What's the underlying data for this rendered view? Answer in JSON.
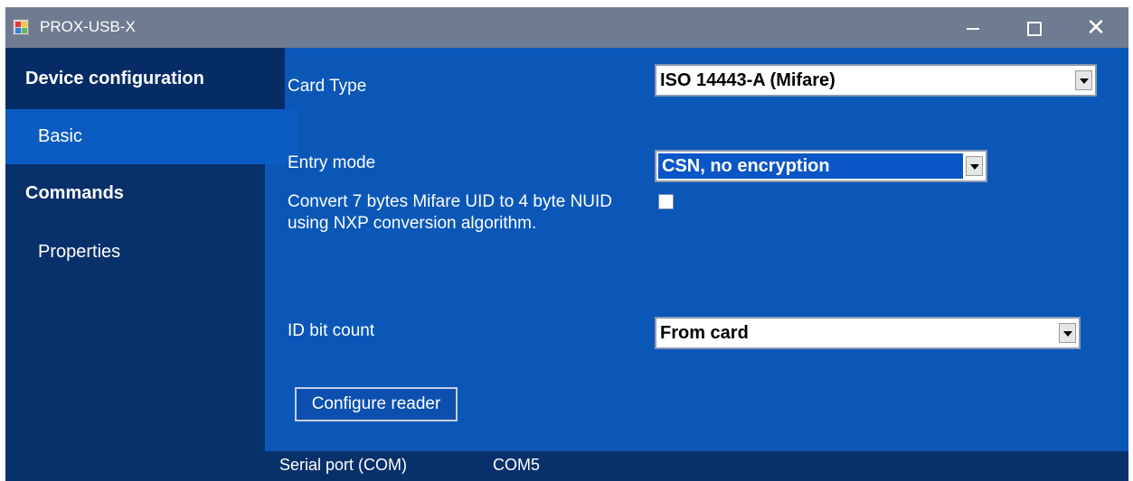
{
  "window": {
    "title": "PROX-USB-X",
    "icon": "app-icon",
    "controls": {
      "minimize": "minimize-icon",
      "maximize": "maximize-icon",
      "close": "close-icon"
    }
  },
  "sidebar": {
    "items": [
      {
        "label": "Device configuration",
        "type": "header"
      },
      {
        "label": "Basic",
        "type": "item",
        "selected": true
      },
      {
        "label": "Commands",
        "type": "header"
      },
      {
        "label": "Properties",
        "type": "item"
      }
    ]
  },
  "form": {
    "card_type": {
      "label": "Card Type",
      "value": "ISO 14443-A (Mifare)"
    },
    "entry_mode": {
      "label": "Entry mode",
      "value": "CSN, no encryption"
    },
    "convert": {
      "label": "Convert 7 bytes Mifare UID to 4 byte NUID using NXP conversion algorithm.",
      "checked": false
    },
    "id_bit_count": {
      "label": "ID bit count",
      "value": "From card"
    },
    "configure_button": "Configure reader"
  },
  "status": {
    "label": "Serial port (COM)",
    "value": "COM5"
  },
  "colors": {
    "background": "#0a57b8",
    "sidebar": "#08306a",
    "selected": "#0b5cc2",
    "titlebar": "#6e7b90"
  }
}
